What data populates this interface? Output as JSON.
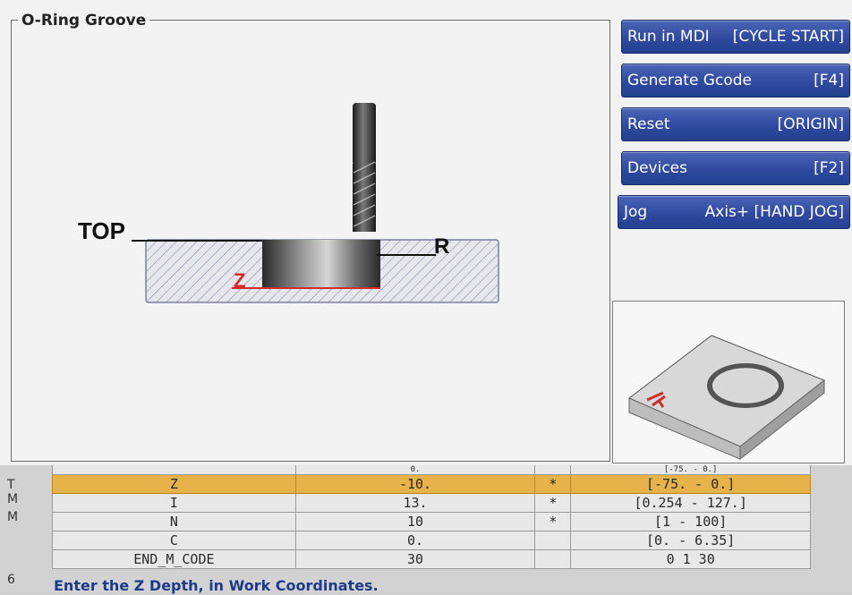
{
  "panel": {
    "title": "O-Ring Groove"
  },
  "diagram": {
    "top_label": "TOP",
    "r_label": "R",
    "z_label": "Z"
  },
  "buttons": [
    {
      "label": "Run in MDI",
      "key": "[CYCLE START]"
    },
    {
      "label": "Generate Gcode",
      "key": "[F4]"
    },
    {
      "label": "Reset",
      "key": "[ORIGIN]"
    },
    {
      "label": "Devices",
      "key": "[F2]"
    },
    {
      "label": "Jog",
      "key": "Axis+ [HAND JOG]"
    }
  ],
  "left_labels": [
    "T",
    "M",
    "M",
    "6"
  ],
  "table": {
    "rows": [
      {
        "name": "",
        "value": "0.",
        "flag": "",
        "range": "[-75. - 0.]",
        "partial": true
      },
      {
        "name": "Z",
        "value": "-10.",
        "flag": "*",
        "range": "[-75. - 0.]",
        "selected": true
      },
      {
        "name": "I",
        "value": "13.",
        "flag": "*",
        "range": "[0.254 - 127.]"
      },
      {
        "name": "N",
        "value": "10",
        "flag": "*",
        "range": "[1 - 100]"
      },
      {
        "name": "C",
        "value": "0.",
        "flag": "",
        "range": "[0. - 6.35]"
      },
      {
        "name": "END_M_CODE",
        "value": "30",
        "flag": "",
        "range": "0 1 30"
      }
    ]
  },
  "prompt": "Enter the Z Depth, in Work Coordinates.",
  "colors": {
    "button": "#2f4a9e",
    "selected_row": "#e6b24a",
    "z_line": "#d22b2b"
  }
}
